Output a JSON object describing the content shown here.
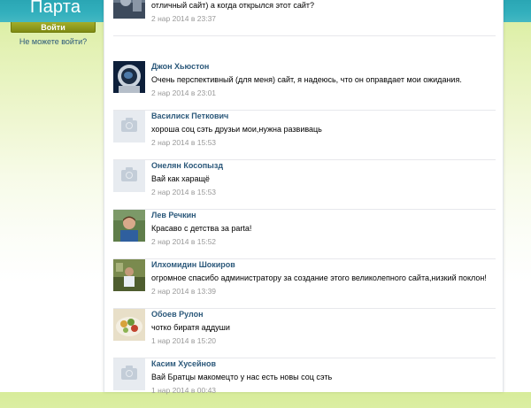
{
  "header": {
    "logo": "Парта"
  },
  "sidebar": {
    "login_button": "Войти",
    "cant_login_link": "Не можете войти?"
  },
  "comments": [
    {
      "name": "",
      "text": "отличный сайт) а когда открылся этот сайт?",
      "date": "2 нар 2014 в 23:37",
      "avatar": "photo"
    },
    {
      "name": "Джон Хьюстон",
      "text": "Очень перспективный (для меня) сайт, я надеюсь, что он оправдает мои ожидания.",
      "date": "2 нар 2014 в 23:01",
      "avatar": "photo"
    },
    {
      "name": "Василиск Петкович",
      "text": "хороша соц сэть друзьи мои,нужна развиваць",
      "date": "2 нар 2014 в 15:53",
      "avatar": "camera-icon"
    },
    {
      "name": "Онелян Косопызд",
      "text": "Вай как харащё",
      "date": "2 нар 2014 в 15:53",
      "avatar": "camera-icon"
    },
    {
      "name": "Лев Речкин",
      "text": "Красаво с детства за parta!",
      "date": "2 нар 2014 в 15:52",
      "avatar": "photo"
    },
    {
      "name": "Илхомидин Шокиров",
      "text": "огромное спасибо администратору за создание этого великолепного сайта,низкий поклон!",
      "date": "2 нар 2014 в 13:39",
      "avatar": "photo"
    },
    {
      "name": "Обоев Рулон",
      "text": "чотко биратя аддуши",
      "date": "1 нар 2014 в 15:20",
      "avatar": "photo"
    },
    {
      "name": "Касим Хусейнов",
      "text": "Вай Братцы макомецто у нас есть новы соц сэть",
      "date": "1 нар 2014 в 00:43",
      "avatar": "camera-icon"
    }
  ]
}
